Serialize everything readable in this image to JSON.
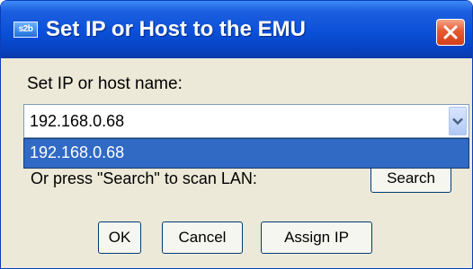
{
  "window": {
    "title": "Set IP or Host to the EMU",
    "app_icon": {
      "name": "app-icon",
      "label": "s2b"
    },
    "close_icon": "close-icon"
  },
  "form": {
    "label": "Set IP or host name:",
    "combo": {
      "value": "192.168.0.68",
      "arrow_icon": "chevron-down-icon"
    },
    "dropdown_options": [
      "192.168.0.68"
    ],
    "behind_text": "Or press \"Search\" to scan LAN:",
    "search_button": "Search"
  },
  "buttons": {
    "ok": "OK",
    "cancel": "Cancel",
    "assign_ip": "Assign IP"
  },
  "colors": {
    "title_bar": "#0a50d8",
    "close_button": "#e65a31",
    "selection": "#316ac5",
    "dialog_background": "#ece9d8"
  }
}
